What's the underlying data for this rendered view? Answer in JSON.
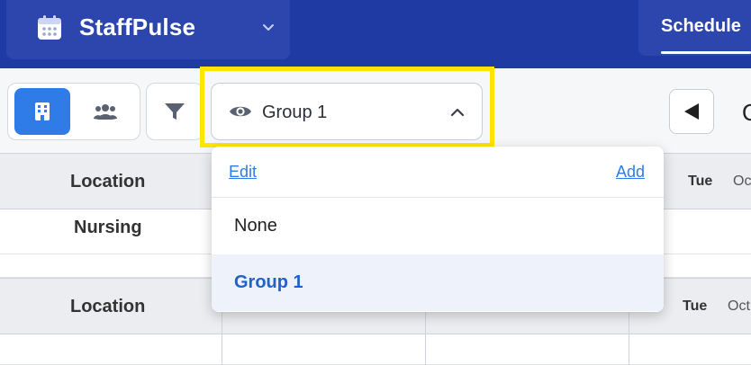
{
  "header": {
    "app_name": "StaffPulse",
    "nav_tab": "Schedule"
  },
  "toolbar": {
    "group_select": {
      "selected": "Group 1"
    },
    "date_fragment": "O"
  },
  "grid": {
    "sections": [
      {
        "column_header": "Location",
        "day": "Tue",
        "month": "Oc",
        "rows": [
          "Nursing"
        ]
      },
      {
        "column_header": "Location",
        "day": "Tue",
        "month": "Oct",
        "rows": []
      }
    ]
  },
  "dropdown": {
    "edit_label": "Edit",
    "add_label": "Add",
    "options": [
      {
        "label": "None",
        "selected": false
      },
      {
        "label": "Group 1",
        "selected": true
      }
    ]
  },
  "colors": {
    "header_bg": "#1f3aa3",
    "accent": "#2f7be8",
    "selected_text": "#2162c9",
    "highlight": "#ffe600"
  },
  "icons": {
    "app_logo": "calendar-icon",
    "app_switch": "chevron-down-icon",
    "view_locations": "building-icon",
    "view_people": "people-icon",
    "filter": "filter-icon",
    "group_visibility": "eye-icon",
    "group_toggle": "chevron-up-icon",
    "previous": "triangle-left-icon"
  }
}
